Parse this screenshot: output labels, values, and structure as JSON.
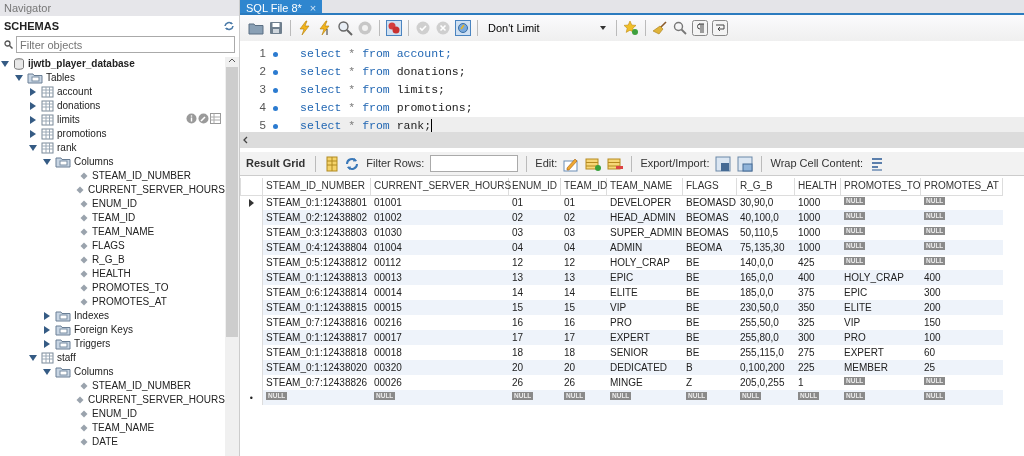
{
  "navigator": {
    "title": "Navigator",
    "section": "SCHEMAS",
    "filter": {
      "placeholder": "Filter objects"
    },
    "tree": [
      {
        "label": "ijwtb_player_database",
        "kind": "schema",
        "expanded": true,
        "children": [
          {
            "label": "Tables",
            "kind": "group",
            "expanded": true,
            "children": [
              {
                "label": "account",
                "kind": "table",
                "expanded": false,
                "hovered": false
              },
              {
                "label": "donations",
                "kind": "table",
                "expanded": false,
                "hovered": false
              },
              {
                "label": "limits",
                "kind": "table",
                "expanded": false,
                "hovered": true
              },
              {
                "label": "promotions",
                "kind": "table",
                "expanded": false,
                "hovered": false
              },
              {
                "label": "rank",
                "kind": "table",
                "expanded": true,
                "hovered": false,
                "children": [
                  {
                    "label": "Columns",
                    "kind": "group",
                    "expanded": true,
                    "children": [
                      {
                        "label": "STEAM_ID_NUMBER",
                        "kind": "column"
                      },
                      {
                        "label": "CURRENT_SERVER_HOURS",
                        "kind": "column"
                      },
                      {
                        "label": "ENUM_ID",
                        "kind": "column"
                      },
                      {
                        "label": "TEAM_ID",
                        "kind": "column"
                      },
                      {
                        "label": "TEAM_NAME",
                        "kind": "column"
                      },
                      {
                        "label": "FLAGS",
                        "kind": "column"
                      },
                      {
                        "label": "R_G_B",
                        "kind": "column"
                      },
                      {
                        "label": "HEALTH",
                        "kind": "column"
                      },
                      {
                        "label": "PROMOTES_TO",
                        "kind": "column"
                      },
                      {
                        "label": "PROMOTES_AT",
                        "kind": "column"
                      }
                    ]
                  },
                  {
                    "label": "Indexes",
                    "kind": "group",
                    "expanded": false
                  },
                  {
                    "label": "Foreign Keys",
                    "kind": "group",
                    "expanded": false
                  },
                  {
                    "label": "Triggers",
                    "kind": "group",
                    "expanded": false
                  }
                ]
              },
              {
                "label": "staff",
                "kind": "table",
                "expanded": true,
                "hovered": false,
                "children": [
                  {
                    "label": "Columns",
                    "kind": "group",
                    "expanded": true,
                    "children": [
                      {
                        "label": "STEAM_ID_NUMBER",
                        "kind": "column"
                      },
                      {
                        "label": "CURRENT_SERVER_HOURS",
                        "kind": "column"
                      },
                      {
                        "label": "ENUM_ID",
                        "kind": "column"
                      },
                      {
                        "label": "TEAM_NAME",
                        "kind": "column"
                      },
                      {
                        "label": "DATE",
                        "kind": "column"
                      }
                    ]
                  }
                ]
              }
            ]
          }
        ]
      }
    ]
  },
  "editor_tab": {
    "label": "SQL File 8*",
    "close": "×"
  },
  "toolbar": {
    "limit": "Don't Limit"
  },
  "editor": {
    "lines": [
      {
        "number": "1",
        "current": false,
        "tokens": [
          {
            "text": "select",
            "kind": "keyword"
          },
          {
            "text": "*",
            "kind": "operator"
          },
          {
            "text": "from",
            "kind": "keyword"
          },
          {
            "text": "account;",
            "kind": "keyword"
          }
        ]
      },
      {
        "number": "2",
        "current": false,
        "tokens": [
          {
            "text": "select",
            "kind": "keyword"
          },
          {
            "text": "*",
            "kind": "operator"
          },
          {
            "text": "from",
            "kind": "keyword"
          },
          {
            "text": "donations;",
            "kind": "plain"
          }
        ]
      },
      {
        "number": "3",
        "current": false,
        "tokens": [
          {
            "text": "select",
            "kind": "keyword"
          },
          {
            "text": "*",
            "kind": "operator"
          },
          {
            "text": "from",
            "kind": "keyword"
          },
          {
            "text": "limits;",
            "kind": "plain"
          }
        ]
      },
      {
        "number": "4",
        "current": false,
        "tokens": [
          {
            "text": "select",
            "kind": "keyword"
          },
          {
            "text": "*",
            "kind": "operator"
          },
          {
            "text": "from",
            "kind": "keyword"
          },
          {
            "text": "promotions;",
            "kind": "plain"
          }
        ]
      },
      {
        "number": "5",
        "current": true,
        "tokens": [
          {
            "text": "select",
            "kind": "keyword"
          },
          {
            "text": "*",
            "kind": "operator"
          },
          {
            "text": "from",
            "kind": "keyword"
          },
          {
            "text": "rank;",
            "kind": "plain"
          }
        ]
      }
    ]
  },
  "result_toolbar": {
    "result_grid": "Result Grid",
    "filter_label": "Filter Rows:",
    "edit_label": "Edit:",
    "export_label": "Export/Import:",
    "wrap_label": "Wrap Cell Content:"
  },
  "table": {
    "columns": [
      "STEAM_ID_NUMBER",
      "CURRENT_SERVER_HOURS",
      "ENUM_ID",
      "TEAM_ID",
      "TEAM_NAME",
      "FLAGS",
      "R_G_B",
      "HEALTH",
      "PROMOTES_TO",
      "PROMOTES_AT"
    ],
    "rows": [
      {
        "selected": true,
        "cells": [
          "STEAM_0:1:12438801",
          "01001",
          "01",
          "01",
          "DEVELOPER",
          "BEOMASD",
          "30,90,0",
          "1000",
          {
            "null": "NULL"
          },
          {
            "null": "NULL"
          }
        ]
      },
      {
        "selected": false,
        "cells": [
          "STEAM_0:2:12438802",
          "01002",
          "02",
          "02",
          "HEAD_ADMIN",
          "BEOMAS",
          "40,100,0",
          "1000",
          {
            "null": "NULL"
          },
          {
            "null": "NULL"
          }
        ]
      },
      {
        "selected": false,
        "cells": [
          "STEAM_0:3:12438803",
          "01030",
          "03",
          "03",
          "SUPER_ADMIN",
          "BEOMAS",
          "50,110,5",
          "1000",
          {
            "null": "NULL"
          },
          {
            "null": "NULL"
          }
        ]
      },
      {
        "selected": false,
        "cells": [
          "STEAM_0:4:12438804",
          "01004",
          "04",
          "04",
          "ADMIN",
          "BEOMA",
          "75,135,30",
          "1000",
          {
            "null": "NULL"
          },
          {
            "null": "NULL"
          }
        ]
      },
      {
        "selected": false,
        "cells": [
          "STEAM_0:5:12438812",
          "00112",
          "12",
          "12",
          "HOLY_CRAP",
          "BE",
          "140,0,0",
          "425",
          {
            "null": "NULL"
          },
          {
            "null": "NULL"
          }
        ]
      },
      {
        "selected": false,
        "cells": [
          "STEAM_0:1:12438813",
          "00013",
          "13",
          "13",
          "EPIC",
          "BE",
          "165,0,0",
          "400",
          "HOLY_CRAP",
          "400"
        ]
      },
      {
        "selected": false,
        "cells": [
          "STEAM_0:6:12438814",
          "00014",
          "14",
          "14",
          "ELITE",
          "BE",
          "185,0,0",
          "375",
          "EPIC",
          "300"
        ]
      },
      {
        "selected": false,
        "cells": [
          "STEAM_0:1:12438815",
          "00015",
          "15",
          "15",
          "VIP",
          "BE",
          "230,50,0",
          "350",
          "ELITE",
          "200"
        ]
      },
      {
        "selected": false,
        "cells": [
          "STEAM_0:7:12438816",
          "00216",
          "16",
          "16",
          "PRO",
          "BE",
          "255,50,0",
          "325",
          "VIP",
          "150"
        ]
      },
      {
        "selected": false,
        "cells": [
          "STEAM_0:1:12438817",
          "00017",
          "17",
          "17",
          "EXPERT",
          "BE",
          "255,80,0",
          "300",
          "PRO",
          "100"
        ]
      },
      {
        "selected": false,
        "cells": [
          "STEAM_0:1:12438818",
          "00018",
          "18",
          "18",
          "SENIOR",
          "BE",
          "255,115,0",
          "275",
          "EXPERT",
          "60"
        ]
      },
      {
        "selected": false,
        "cells": [
          "STEAM_0:1:12438020",
          "00320",
          "20",
          "20",
          "DEDICATED",
          "B",
          "0,100,200",
          "225",
          "MEMBER",
          "25"
        ]
      },
      {
        "selected": false,
        "cells": [
          "STEAM_0:7:12438826",
          "00026",
          "26",
          "26",
          "MINGE",
          "Z",
          "205,0,255",
          "1",
          {
            "null": "NULL"
          },
          {
            "null": "NULL"
          }
        ]
      }
    ],
    "new_row": {
      "marker": "•",
      "cells": [
        {
          "null": "NULL"
        },
        {
          "null": "NULL"
        },
        {
          "null": "NULL"
        },
        {
          "null": "NULL"
        },
        {
          "null": "NULL"
        },
        {
          "null": "NULL"
        },
        {
          "null": "NULL"
        },
        {
          "null": "NULL"
        },
        {
          "null": "NULL"
        },
        {
          "null": "NULL"
        }
      ]
    }
  }
}
